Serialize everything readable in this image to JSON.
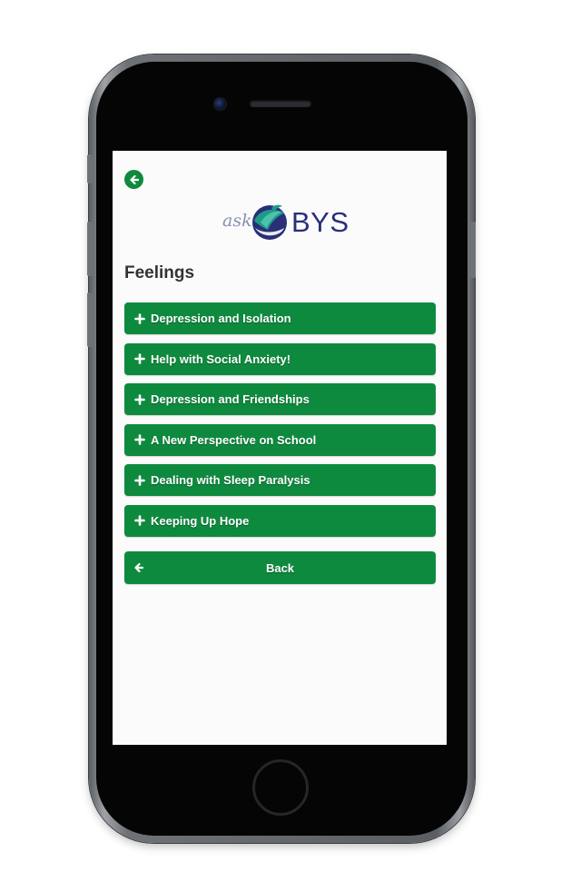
{
  "device": {
    "frame_color": "#6e7175",
    "screen_background": "#fbfbfb"
  },
  "header": {
    "back_icon": "arrow-left-icon",
    "logo_ask_text": "ask",
    "logo_brand_text": "BYS"
  },
  "page": {
    "title": "Feelings"
  },
  "accent_color": "#0e8a3e",
  "menu": {
    "items": [
      {
        "label": "Depression and Isolation",
        "icon": "plus-icon"
      },
      {
        "label": "Help with Social Anxiety!",
        "icon": "plus-icon"
      },
      {
        "label": "Depression and Friendships",
        "icon": "plus-icon"
      },
      {
        "label": "A New Perspective on School",
        "icon": "plus-icon"
      },
      {
        "label": "Dealing with Sleep Paralysis",
        "icon": "plus-icon"
      },
      {
        "label": "Keeping Up Hope",
        "icon": "plus-icon"
      }
    ]
  },
  "back_button": {
    "label": "Back",
    "icon": "arrow-left-icon"
  }
}
